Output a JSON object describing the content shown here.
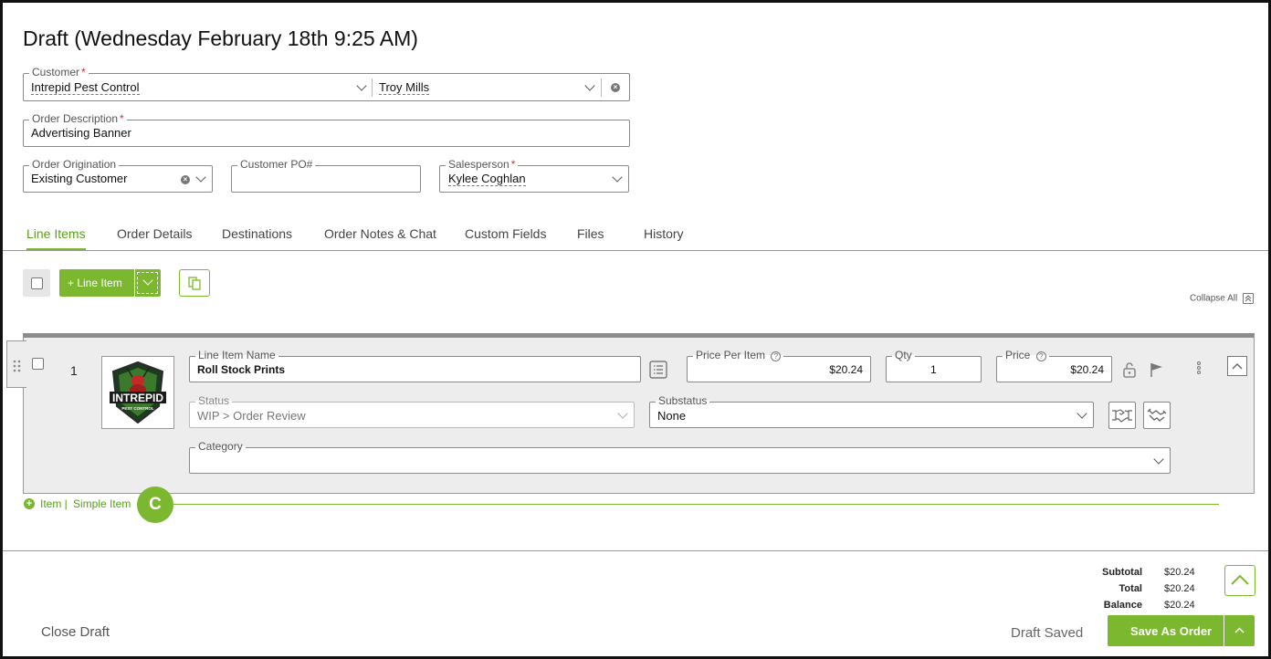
{
  "page": {
    "title": "Draft (Wednesday February 18th 9:25 AM)"
  },
  "form": {
    "customer": {
      "label": "Customer",
      "required": "*",
      "value": "Intrepid Pest Control",
      "contact": "Troy Mills"
    },
    "order_description": {
      "label": "Order Description",
      "required": "*",
      "value": "Advertising Banner"
    },
    "order_origination": {
      "label": "Order Origination",
      "value": "Existing Customer"
    },
    "customer_po": {
      "label": "Customer PO#",
      "value": ""
    },
    "salesperson": {
      "label": "Salesperson",
      "required": "*",
      "value": "Kylee Coghlan"
    }
  },
  "tabs": [
    {
      "label": "Line Items",
      "active": true
    },
    {
      "label": "Order Details"
    },
    {
      "label": "Destinations"
    },
    {
      "label": "Order Notes & Chat"
    },
    {
      "label": "Custom Fields"
    },
    {
      "label": "Files"
    },
    {
      "label": "History"
    }
  ],
  "toolbar": {
    "add_line_item_label": "+ Line Item",
    "collapse_all_label": "Collapse All"
  },
  "line_item": {
    "number": "1",
    "logo_text": "INTREPID",
    "logo_subtext": "PEST CONTROL",
    "name_label": "Line Item Name",
    "name_value": "Roll Stock Prints",
    "price_per_item_label": "Price Per Item",
    "price_per_item_value": "$20.24",
    "qty_label": "Qty",
    "qty_value": "1",
    "price_label": "Price",
    "price_value": "$20.24",
    "status_label": "Status",
    "status_value": "WIP > Order Review",
    "substatus_label": "Substatus",
    "substatus_value": "None",
    "category_label": "Category",
    "category_value": ""
  },
  "add_links": {
    "item_label": "Item |",
    "simple_item_label": "Simple Item",
    "badge": "C"
  },
  "footer": {
    "subtotal_label": "Subtotal",
    "subtotal_value": "$20.24",
    "total_label": "Total",
    "total_value": "$20.24",
    "balance_label": "Balance",
    "balance_value": "$20.24",
    "close_draft_label": "Close Draft",
    "draft_saved_label": "Draft Saved",
    "save_as_order_label": "Save As Order"
  },
  "colors": {
    "accent": "#7cb82f",
    "required": "#d32f2f"
  }
}
